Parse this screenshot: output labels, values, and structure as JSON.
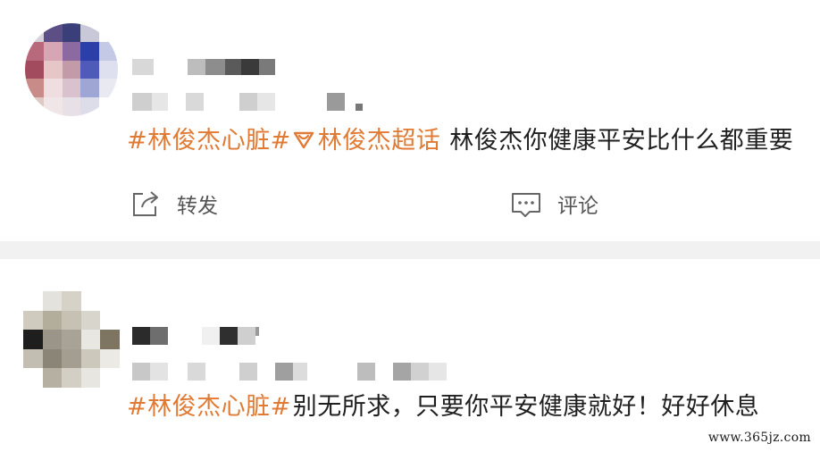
{
  "posts": [
    {
      "topics": "#林俊杰心脏#",
      "supertopic_icon": "diamond-supertopic-icon",
      "supertopic": "林俊杰超话",
      "text": "林俊杰你健康平安比什么都重要",
      "actions": {
        "repost_label": "转发",
        "comment_label": "评论"
      }
    },
    {
      "topics": "#林俊杰心脏#",
      "text": "别无所求，只要你平安健康就好！好好休息"
    }
  ],
  "watermark": "www.365jz.com",
  "colors": {
    "topic": "#e07a34",
    "text": "#1f1f1f",
    "action": "#555555",
    "separator": "#f1f1f1"
  }
}
